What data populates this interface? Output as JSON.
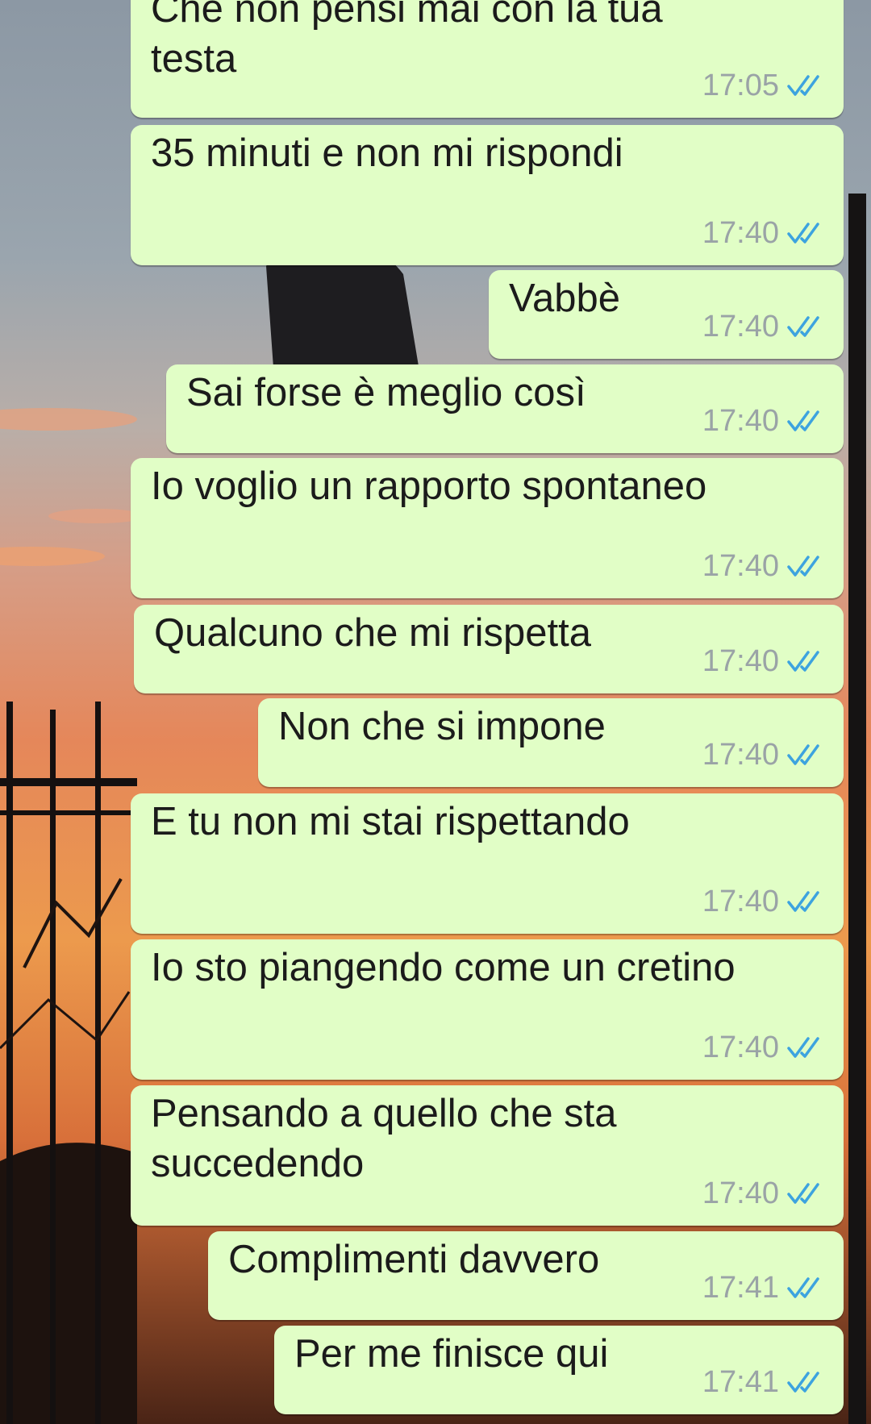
{
  "theme": {
    "bubble_color": "#e1fec6",
    "text_color": "#1b1b1b",
    "time_color": "#9aa3a6",
    "tick_color": "#3da3df"
  },
  "messages": [
    {
      "lines": [
        "Che non pensi mai con la tua",
        "testa"
      ],
      "time": "17:05",
      "status": "read-double-tick-icon"
    },
    {
      "lines": [
        "35 minuti e non mi rispondi"
      ],
      "time": "17:40",
      "status": "read-double-tick-icon"
    },
    {
      "lines": [
        "Vabbè"
      ],
      "time": "17:40",
      "status": "read-double-tick-icon"
    },
    {
      "lines": [
        "Sai forse è meglio così"
      ],
      "time": "17:40",
      "status": "read-double-tick-icon"
    },
    {
      "lines": [
        "Io voglio un rapporto spontaneo"
      ],
      "time": "17:40",
      "status": "read-double-tick-icon"
    },
    {
      "lines": [
        "Qualcuno che mi rispetta"
      ],
      "time": "17:40",
      "status": "read-double-tick-icon"
    },
    {
      "lines": [
        "Non che si impone"
      ],
      "time": "17:40",
      "status": "read-double-tick-icon"
    },
    {
      "lines": [
        "E tu non mi stai rispettando"
      ],
      "time": "17:40",
      "status": "read-double-tick-icon"
    },
    {
      "lines": [
        "Io sto piangendo come un cretino"
      ],
      "time": "17:40",
      "status": "read-double-tick-icon"
    },
    {
      "lines": [
        "Pensando a quello che sta",
        "succedendo"
      ],
      "time": "17:40",
      "status": "read-double-tick-icon"
    },
    {
      "lines": [
        "Complimenti davvero"
      ],
      "time": "17:41",
      "status": "read-double-tick-icon"
    },
    {
      "lines": [
        "Per me finisce qui"
      ],
      "time": "17:41",
      "status": "read-double-tick-icon"
    }
  ]
}
